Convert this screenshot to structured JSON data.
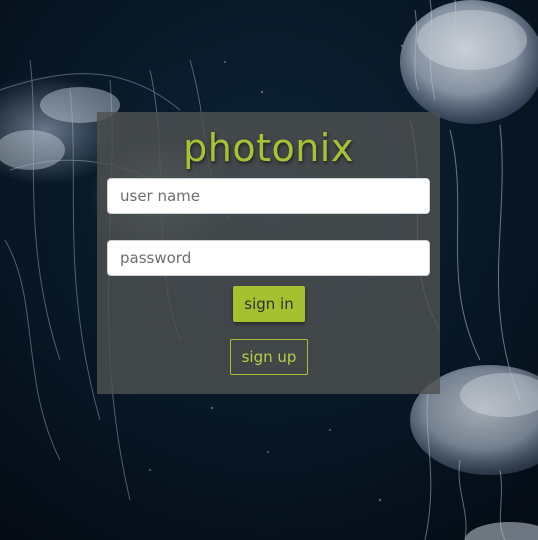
{
  "app": {
    "logo_text": "photonix"
  },
  "login": {
    "username_placeholder": "user name",
    "password_placeholder": "password",
    "sign_in_label": "sign in",
    "sign_up_label": "sign up"
  },
  "colors": {
    "brand_green": "#a8c234",
    "sign_in_bg": "#a6c02f",
    "sign_up_border": "#a8c234",
    "sign_up_text": "#b6cf45",
    "background": "#07111d"
  },
  "background_image": {
    "subject": "jellyfish"
  }
}
